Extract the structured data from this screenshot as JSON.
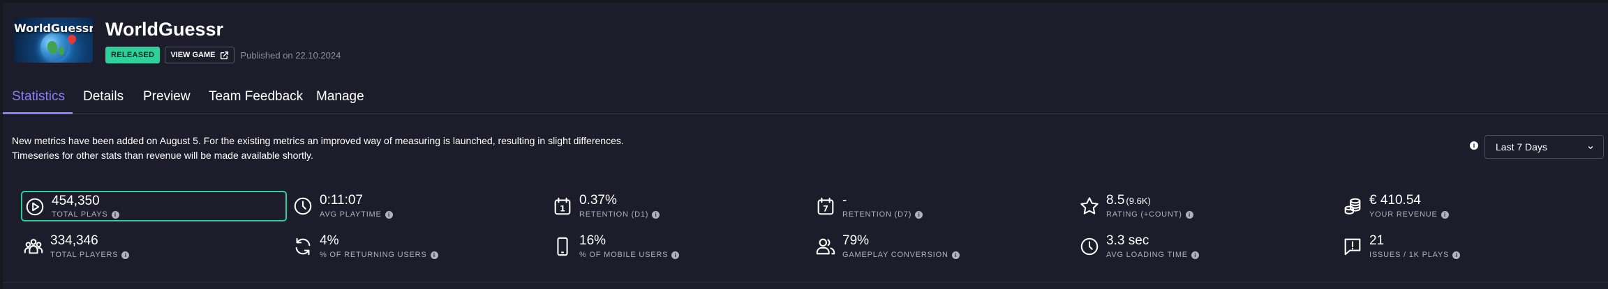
{
  "game": {
    "thumbnail_text": "WorldGuessr",
    "title": "WorldGuessr",
    "status": "RELEASED",
    "view_game": "VIEW GAME",
    "published": "Published on 22.10.2024"
  },
  "tabs": [
    "Statistics",
    "Details",
    "Preview",
    "Team Feedback",
    "Manage"
  ],
  "active_tab": "Statistics",
  "notice": {
    "line1": "New metrics have been added on August 5. For the existing metrics an improved way of measuring is launched, resulting in slight differences.",
    "line2": "Timeseries for other stats than revenue will be made available shortly."
  },
  "range_select": {
    "value": "Last 7 Days"
  },
  "colors": {
    "accent": "#8f7cf8",
    "released": "#2fd09b",
    "background": "#1c1c2a"
  },
  "stats": [
    {
      "value": "454,350",
      "label": "TOTAL PLAYS",
      "icon": "play-circle-icon"
    },
    {
      "value": "0:11:07",
      "label": "AVG PLAYTIME",
      "icon": "clock-icon"
    },
    {
      "value": "0.37%",
      "label": "RETENTION (D1)",
      "icon": "calendar-1-icon"
    },
    {
      "value": "-",
      "label": "RETENTION (D7)",
      "icon": "calendar-7-icon"
    },
    {
      "value": "8.5",
      "sub": "(9.6K)",
      "label": "RATING (+COUNT)",
      "icon": "star-icon"
    },
    {
      "value": "€ 410.54",
      "label": "YOUR REVENUE",
      "icon": "coins-icon"
    },
    {
      "value": "334,346",
      "label": "TOTAL PLAYERS",
      "icon": "players-icon"
    },
    {
      "value": "4%",
      "label": "% OF RETURNING USERS",
      "icon": "refresh-icon"
    },
    {
      "value": "16%",
      "label": "% OF MOBILE USERS",
      "icon": "mobile-icon"
    },
    {
      "value": "79%",
      "label": "GAMEPLAY CONVERSION",
      "icon": "users-icon"
    },
    {
      "value": "3.3 sec",
      "label": "AVG LOADING TIME",
      "icon": "clock-icon"
    },
    {
      "value": "21",
      "label": "ISSUES / 1K PLAYS",
      "icon": "issues-icon"
    }
  ]
}
